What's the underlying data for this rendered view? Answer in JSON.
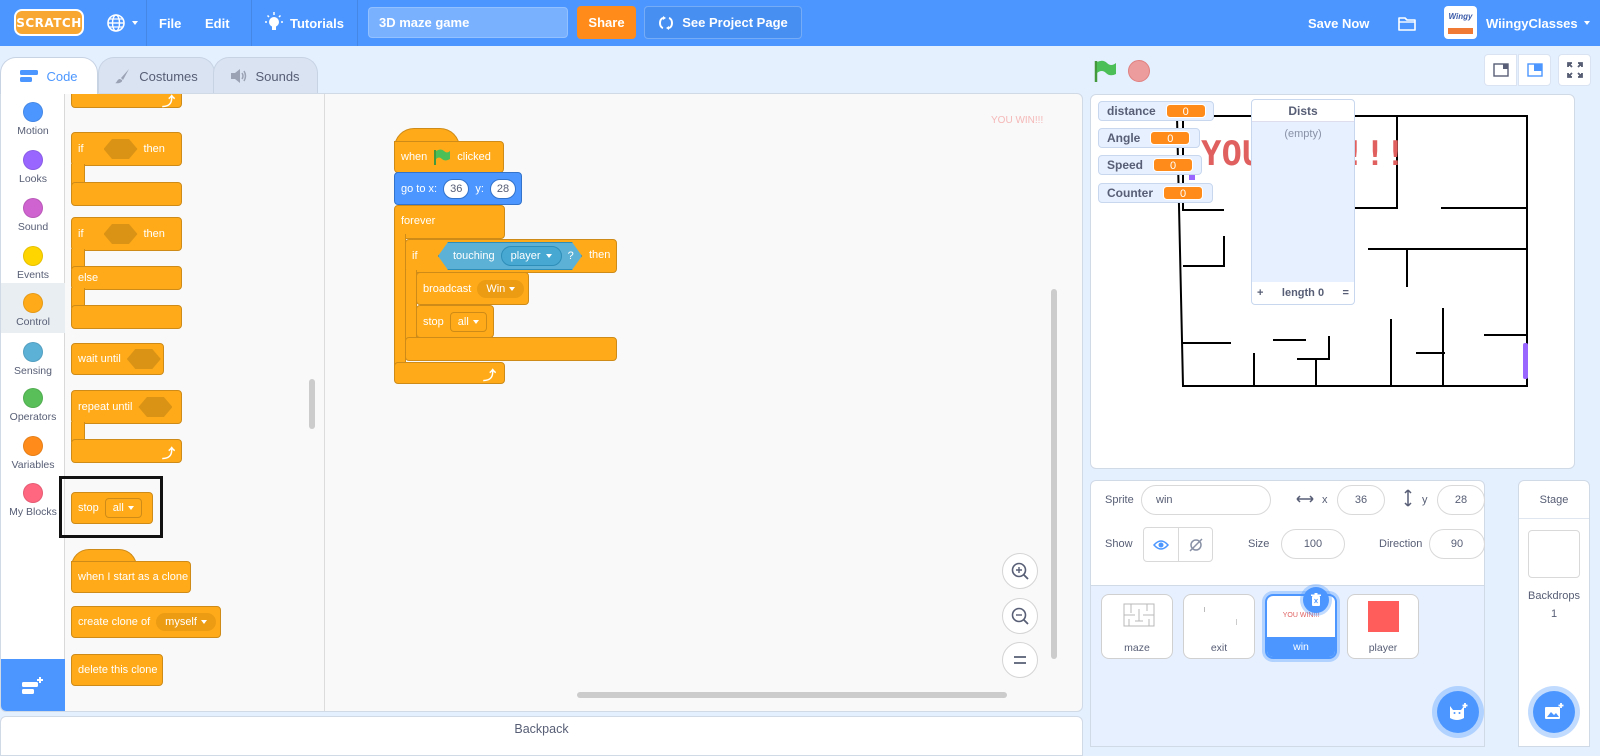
{
  "menubar": {
    "logo": "SCRATCH",
    "file": "File",
    "edit": "Edit",
    "tutorials": "Tutorials",
    "project_title": "3D maze game",
    "share": "Share",
    "see_project_page": "See Project Page",
    "save_now": "Save Now",
    "username": "WiingyClasses",
    "avatar_text": "Wingy"
  },
  "tabs": [
    {
      "label": "Code",
      "active": true
    },
    {
      "label": "Costumes",
      "active": false
    },
    {
      "label": "Sounds",
      "active": false
    }
  ],
  "categories": [
    {
      "label": "Motion",
      "color": "#4c97ff"
    },
    {
      "label": "Looks",
      "color": "#9966ff"
    },
    {
      "label": "Sound",
      "color": "#cf63cf"
    },
    {
      "label": "Events",
      "color": "#ffd500"
    },
    {
      "label": "Control",
      "color": "#ffab19",
      "selected": true
    },
    {
      "label": "Sensing",
      "color": "#5cb1d6"
    },
    {
      "label": "Operators",
      "color": "#59c059"
    },
    {
      "label": "Variables",
      "color": "#ff8c1a"
    },
    {
      "label": "My Blocks",
      "color": "#ff6680"
    }
  ],
  "palette": {
    "if_then": {
      "if": "if",
      "then": "then"
    },
    "if_else": {
      "if": "if",
      "then": "then",
      "else": "else"
    },
    "wait_until": "wait until",
    "repeat_until": "repeat until",
    "stop": {
      "label": "stop",
      "option": "all"
    },
    "when_clone": "when I start as a clone",
    "create_clone": {
      "label": "create clone of",
      "option": "myself"
    },
    "delete_clone": "delete this clone"
  },
  "script": {
    "hat": {
      "when": "when",
      "clicked": "clicked"
    },
    "goto": {
      "label": "go to x:",
      "x": "36",
      "ylabel": "y:",
      "y": "28"
    },
    "forever": "forever",
    "if": {
      "if": "if",
      "then": "then",
      "touching": "touching",
      "target": "player",
      "q": "?"
    },
    "broadcast": {
      "label": "broadcast",
      "message": "Win"
    },
    "stop": {
      "label": "stop",
      "option": "all"
    }
  },
  "canvas_watermark": "YOU WIN!!!",
  "backpack": "Backpack",
  "stage": {
    "monitors": [
      {
        "name": "distance",
        "value": "0"
      },
      {
        "name": "Angle",
        "value": "0"
      },
      {
        "name": "Speed",
        "value": "0"
      },
      {
        "name": "Counter",
        "value": "0"
      }
    ],
    "list": {
      "name": "Dists",
      "empty": "(empty)",
      "add": "+",
      "length": "length 0",
      "resize": "="
    },
    "win_text": "YOU WIN!!!"
  },
  "sprite_info": {
    "sprite_label": "Sprite",
    "sprite_name": "win",
    "x_label": "x",
    "x": "36",
    "y_label": "y",
    "y": "28",
    "show_label": "Show",
    "size_label": "Size",
    "size": "100",
    "direction_label": "Direction",
    "direction": "90"
  },
  "sprites": [
    {
      "name": "maze",
      "selected": false
    },
    {
      "name": "exit",
      "selected": false
    },
    {
      "name": "win",
      "selected": true,
      "thumb_text": "YOU WIN!!!"
    },
    {
      "name": "player",
      "selected": false
    }
  ],
  "stage_panel": {
    "title": "Stage",
    "backdrops_label": "Backdrops",
    "backdrops_count": "1"
  }
}
